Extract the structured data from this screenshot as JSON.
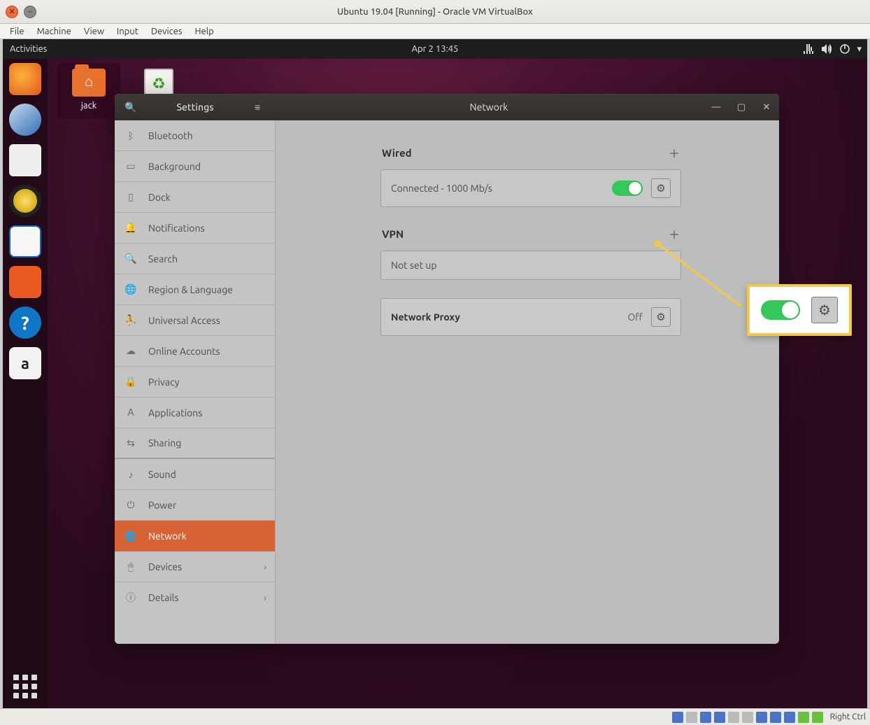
{
  "virtualbox": {
    "title": "Ubuntu 19.04 [Running] - Oracle VM VirtualBox",
    "menus": [
      "File",
      "Machine",
      "View",
      "Input",
      "Devices",
      "Help"
    ],
    "hostkey": "Right Ctrl"
  },
  "gnome": {
    "activities": "Activities",
    "clock": "Apr 2  13:45"
  },
  "desktop_icons": [
    {
      "id": "home",
      "label": "jack",
      "selected": true
    },
    {
      "id": "trash",
      "label": "Trash",
      "selected": false
    }
  ],
  "settings": {
    "app_title": "Settings",
    "page_title": "Network",
    "sidebar": [
      {
        "icon": "bluetooth",
        "label": "Bluetooth"
      },
      {
        "icon": "background",
        "label": "Background"
      },
      {
        "icon": "dock",
        "label": "Dock"
      },
      {
        "icon": "notifications",
        "label": "Notifications"
      },
      {
        "icon": "search",
        "label": "Search"
      },
      {
        "icon": "region",
        "label": "Region & Language"
      },
      {
        "icon": "universal",
        "label": "Universal Access"
      },
      {
        "icon": "online",
        "label": "Online Accounts"
      },
      {
        "icon": "privacy",
        "label": "Privacy"
      },
      {
        "icon": "apps",
        "label": "Applications"
      },
      {
        "icon": "sharing",
        "label": "Sharing"
      },
      {
        "icon": "sound",
        "label": "Sound"
      },
      {
        "icon": "power",
        "label": "Power"
      },
      {
        "icon": "network",
        "label": "Network",
        "selected": true
      },
      {
        "icon": "devices",
        "label": "Devices",
        "chevron": true
      },
      {
        "icon": "details",
        "label": "Details",
        "chevron": true
      }
    ],
    "sections": {
      "wired": {
        "title": "Wired",
        "status": "Connected - 1000 Mb/s",
        "enabled": true
      },
      "vpn": {
        "title": "VPN",
        "status": "Not set up"
      },
      "proxy": {
        "title": "Network Proxy",
        "status": "Off"
      }
    }
  },
  "icon_glyphs": {
    "bluetooth": "ᛒ",
    "background": "▭",
    "dock": "▯",
    "notifications": "🔔",
    "search": "🔍",
    "region": "🌐",
    "universal": "⛹",
    "online": "☁",
    "privacy": "🔒",
    "apps": "𝖠",
    "sharing": "⇆",
    "sound": "♪",
    "power": "⏻",
    "network": "🌐",
    "devices": "🖱",
    "details": "ⓘ"
  }
}
